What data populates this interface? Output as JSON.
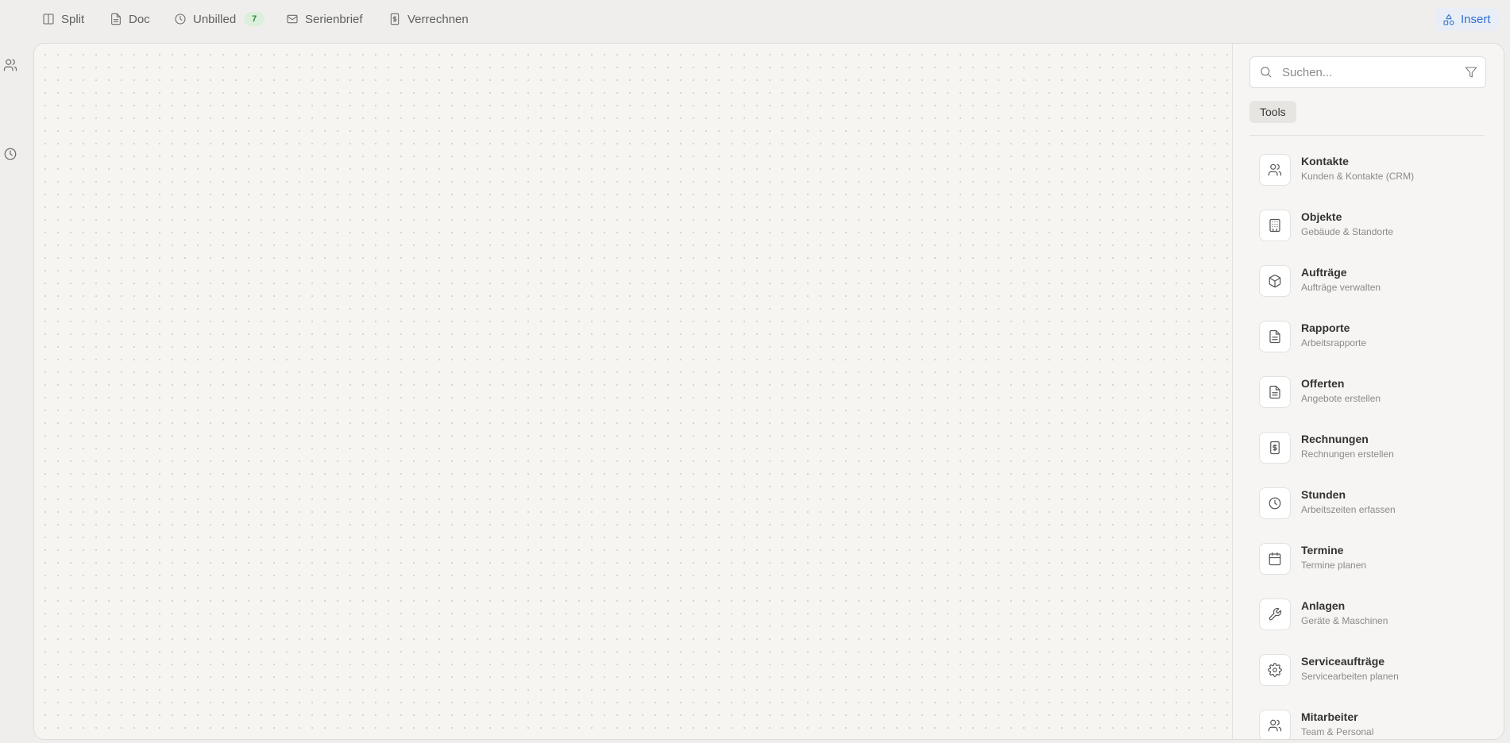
{
  "toolbar": {
    "items": [
      {
        "label": "Split",
        "icon": "split-columns-icon"
      },
      {
        "label": "Doc",
        "icon": "document-icon"
      },
      {
        "label": "Unbilled",
        "icon": "clock-icon",
        "badge": "7"
      },
      {
        "label": "Serienbrief",
        "icon": "mail-icon"
      },
      {
        "label": "Verrechnen",
        "icon": "dollar-file-icon"
      }
    ],
    "insert_label": "Insert"
  },
  "left_rail": {
    "icons": [
      "users-icon",
      "clock-icon"
    ]
  },
  "panel": {
    "search_placeholder": "Suchen...",
    "tab_label": "Tools",
    "tools": [
      {
        "title": "Kontakte",
        "subtitle": "Kunden & Kontakte (CRM)",
        "icon": "users-icon"
      },
      {
        "title": "Objekte",
        "subtitle": "Gebäude & Standorte",
        "icon": "building-icon"
      },
      {
        "title": "Aufträge",
        "subtitle": "Aufträge verwalten",
        "icon": "package-icon"
      },
      {
        "title": "Rapporte",
        "subtitle": "Arbeitsrapporte",
        "icon": "file-text-icon"
      },
      {
        "title": "Offerten",
        "subtitle": "Angebote erstellen",
        "icon": "file-text-icon"
      },
      {
        "title": "Rechnungen",
        "subtitle": "Rechnungen erstellen",
        "icon": "invoice-icon"
      },
      {
        "title": "Stunden",
        "subtitle": "Arbeitszeiten erfassen",
        "icon": "clock-icon"
      },
      {
        "title": "Termine",
        "subtitle": "Termine planen",
        "icon": "calendar-icon"
      },
      {
        "title": "Anlagen",
        "subtitle": "Geräte & Maschinen",
        "icon": "wrench-icon"
      },
      {
        "title": "Serviceaufträge",
        "subtitle": "Servicearbeiten planen",
        "icon": "gear-icon"
      },
      {
        "title": "Mitarbeiter",
        "subtitle": "Team & Personal",
        "icon": "users-icon"
      }
    ]
  },
  "colors": {
    "accent": "#2d6fd4",
    "badge_bg": "#dcefdc",
    "badge_text": "#2f8a3a",
    "canvas_bg": "#f6f5f2"
  }
}
